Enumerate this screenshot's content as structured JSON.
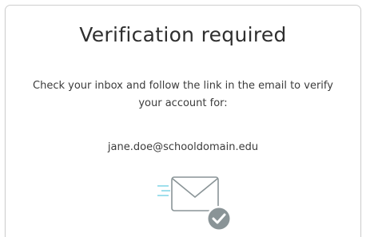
{
  "dialog": {
    "title": "Verification required",
    "message": "Check your inbox and follow the link in the email to verify your account for:",
    "email": "jane.doe@schooldomain.edu",
    "icon": "envelope-check-icon"
  },
  "colors": {
    "border": "#cfcfcf",
    "text": "#333333",
    "icon_stroke": "#8a9497",
    "check_badge": "#8a9497",
    "speed_lines": "#7fd4e6"
  }
}
